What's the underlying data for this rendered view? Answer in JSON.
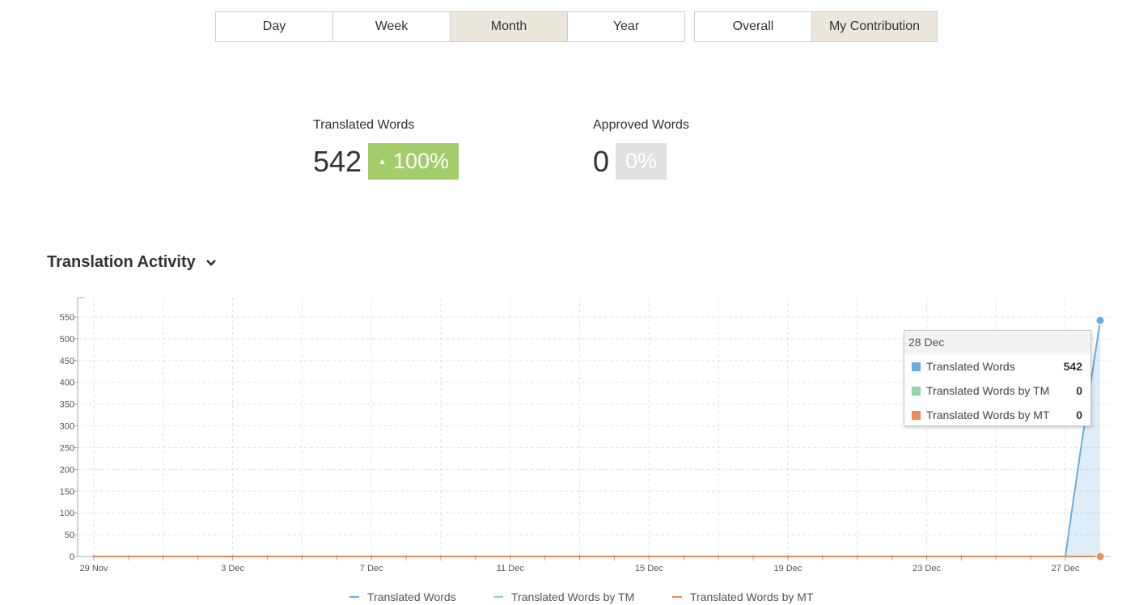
{
  "period_buttons": [
    {
      "label": "Day",
      "active": false
    },
    {
      "label": "Week",
      "active": false
    },
    {
      "label": "Month",
      "active": true
    },
    {
      "label": "Year",
      "active": false
    }
  ],
  "scope_buttons": [
    {
      "label": "Overall",
      "active": false
    },
    {
      "label": "My Contribution",
      "active": true
    }
  ],
  "stats": {
    "translated": {
      "label": "Translated Words",
      "value": "542",
      "change": "100%",
      "trend": "up",
      "color": "#a3cd6b"
    },
    "approved": {
      "label": "Approved Words",
      "value": "0",
      "change": "0%",
      "trend": "none",
      "color": "#e0e0e0"
    }
  },
  "section": {
    "title": "Translation Activity",
    "dropdown_icon": "chevron-down-icon"
  },
  "tooltip": {
    "date": "28 Dec",
    "rows": [
      {
        "name": "Translated Words",
        "value": "542",
        "color": "#6aaee0"
      },
      {
        "name": "Translated Words by TM",
        "value": "0",
        "color": "#8fd6a8"
      },
      {
        "name": "Translated Words by MT",
        "value": "0",
        "color": "#ec8a5c"
      }
    ]
  },
  "chart_data": {
    "type": "area",
    "x_tick_labels": [
      "29 Nov",
      "3 Dec",
      "7 Dec",
      "11 Dec",
      "15 Dec",
      "19 Dec",
      "23 Dec",
      "27 Dec"
    ],
    "x": [
      "29 Nov",
      "30 Nov",
      "1 Dec",
      "2 Dec",
      "3 Dec",
      "4 Dec",
      "5 Dec",
      "6 Dec",
      "7 Dec",
      "8 Dec",
      "9 Dec",
      "10 Dec",
      "11 Dec",
      "12 Dec",
      "13 Dec",
      "14 Dec",
      "15 Dec",
      "16 Dec",
      "17 Dec",
      "18 Dec",
      "19 Dec",
      "20 Dec",
      "21 Dec",
      "22 Dec",
      "23 Dec",
      "24 Dec",
      "25 Dec",
      "26 Dec",
      "27 Dec",
      "28 Dec"
    ],
    "ylim": [
      0,
      550
    ],
    "y_ticks": [
      0,
      50,
      100,
      150,
      200,
      250,
      300,
      350,
      400,
      450,
      500,
      550
    ],
    "grid": true,
    "legend_position": "bottom-center",
    "series": [
      {
        "name": "Translated Words",
        "color": "#6aaee0",
        "values": [
          0,
          0,
          0,
          0,
          0,
          0,
          0,
          0,
          0,
          0,
          0,
          0,
          0,
          0,
          0,
          0,
          0,
          0,
          0,
          0,
          0,
          0,
          0,
          0,
          0,
          0,
          0,
          0,
          0,
          542
        ]
      },
      {
        "name": "Translated Words by TM",
        "color": "#8fd6a8",
        "values": [
          0,
          0,
          0,
          0,
          0,
          0,
          0,
          0,
          0,
          0,
          0,
          0,
          0,
          0,
          0,
          0,
          0,
          0,
          0,
          0,
          0,
          0,
          0,
          0,
          0,
          0,
          0,
          0,
          0,
          0
        ]
      },
      {
        "name": "Translated Words by MT",
        "color": "#ec8a5c",
        "values": [
          0,
          0,
          0,
          0,
          0,
          0,
          0,
          0,
          0,
          0,
          0,
          0,
          0,
          0,
          0,
          0,
          0,
          0,
          0,
          0,
          0,
          0,
          0,
          0,
          0,
          0,
          0,
          0,
          0,
          0
        ]
      }
    ]
  }
}
